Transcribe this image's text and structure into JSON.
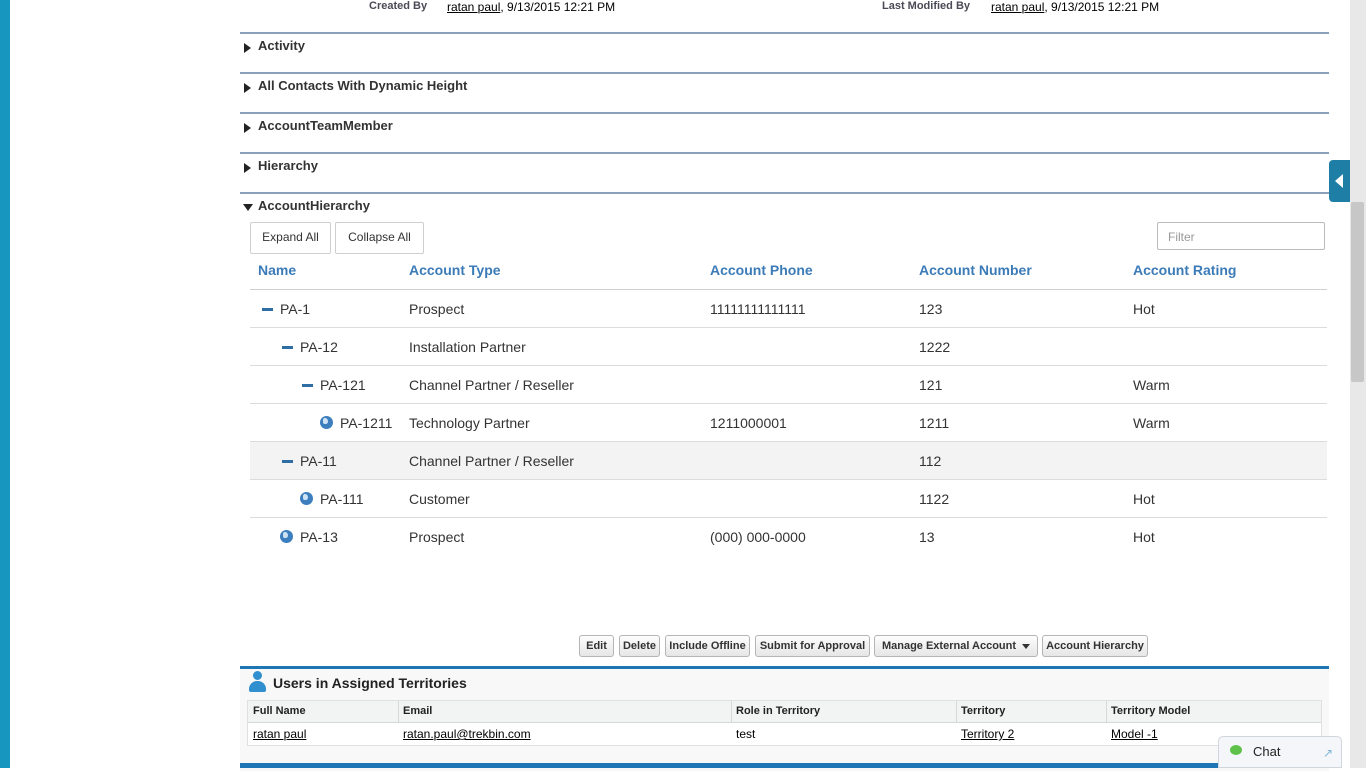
{
  "top_info": {
    "created_by_label": "Created By",
    "created_by_user": "ratan paul",
    "created_by_date": ", 9/13/2015 12:21 PM",
    "modified_by_label": "Last Modified By",
    "modified_by_user": "ratan paul",
    "modified_by_date": ", 9/13/2015 12:21 PM"
  },
  "sections": [
    {
      "title": "Activity"
    },
    {
      "title": "All Contacts With Dynamic Height"
    },
    {
      "title": "AccountTeamMember"
    },
    {
      "title": "Hierarchy"
    },
    {
      "title": "AccountHierarchy"
    }
  ],
  "hierarchy": {
    "expand_all": "Expand All",
    "collapse_all": "Collapse All",
    "filter_placeholder": "Filter",
    "columns": [
      "Name",
      "Account Type",
      "Account Phone",
      "Account Number",
      "Account Rating"
    ],
    "rows": [
      {
        "name": "PA-1",
        "type": "Prospect",
        "phone": "11111111111111",
        "number": "123",
        "rating": "Hot"
      },
      {
        "name": "PA-12",
        "type": "Installation Partner",
        "phone": "",
        "number": "1222",
        "rating": ""
      },
      {
        "name": "PA-121",
        "type": "Channel Partner / Reseller",
        "phone": "",
        "number": "121",
        "rating": "Warm"
      },
      {
        "name": "PA-1211",
        "type": "Technology Partner",
        "phone": "1211000001",
        "number": "1211",
        "rating": "Warm"
      },
      {
        "name": "PA-11",
        "type": "Channel Partner / Reseller",
        "phone": "",
        "number": "112",
        "rating": ""
      },
      {
        "name": "PA-111",
        "type": "Customer",
        "phone": "",
        "number": "1122",
        "rating": "Hot"
      },
      {
        "name": "PA-13",
        "type": "Prospect",
        "phone": "(000) 000-0000",
        "number": "13",
        "rating": "Hot"
      }
    ]
  },
  "buttons": {
    "edit": "Edit",
    "delete": "Delete",
    "include_offline": "Include Offline",
    "submit_approval": "Submit for Approval",
    "manage_external": "Manage External Account",
    "account_hierarchy": "Account Hierarchy"
  },
  "territories": {
    "title": "Users in Assigned Territories",
    "columns": [
      "Full Name",
      "Email",
      "Role in Territory",
      "Territory",
      "Territory Model"
    ],
    "row": {
      "full_name": "ratan paul",
      "email": "ratan.paul@trekbin.com",
      "role": "test",
      "territory": "Territory 2",
      "model": "Model -1"
    }
  },
  "chat": {
    "label": "Chat"
  },
  "colors": {
    "accent": "#1797c0",
    "link_header": "#3b7bb8",
    "section_border": "#8aa0bb"
  }
}
